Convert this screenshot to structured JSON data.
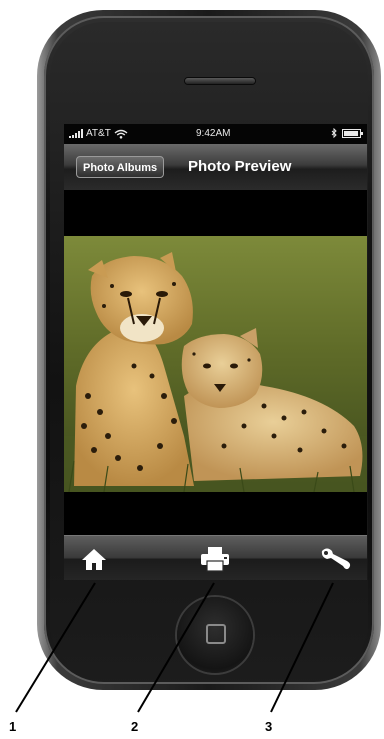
{
  "status_bar": {
    "carrier": "AT&T",
    "time": "9:42AM",
    "signal_bars": 5,
    "battery_level": 0.9
  },
  "nav_bar": {
    "back_button_label": "Photo Albums",
    "title": "Photo Preview"
  },
  "photo": {
    "subject": "cheetahs"
  },
  "toolbar": {
    "items": [
      {
        "icon": "home-icon"
      },
      {
        "icon": "print-icon"
      },
      {
        "icon": "wrench-icon"
      }
    ]
  },
  "callouts": {
    "labels": [
      "1",
      "2",
      "3"
    ]
  },
  "colors": {
    "screen_bg": "#000000",
    "nav_bar_top": "#6a6a6a",
    "phone_body": "#1a1a1a"
  }
}
